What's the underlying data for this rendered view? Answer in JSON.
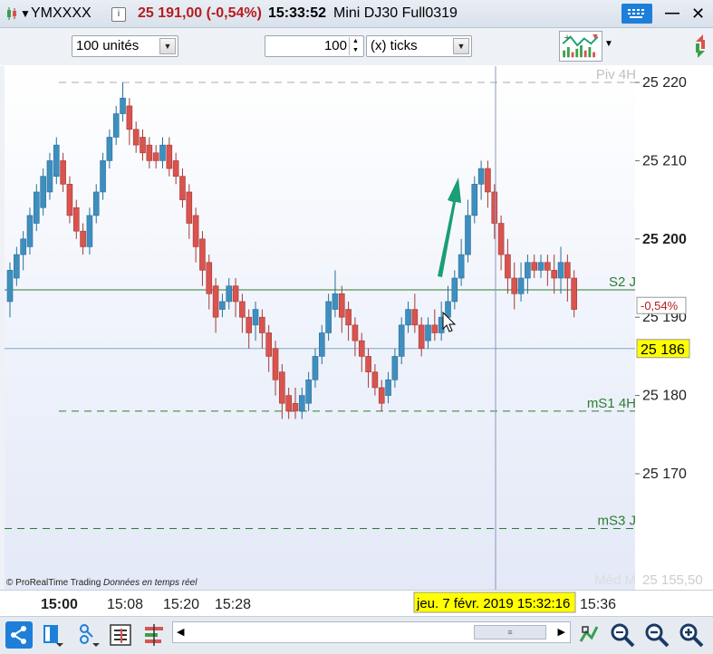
{
  "window": {
    "instrument": "YMXXXX",
    "price_change": "25 191,00 (-0,54%)",
    "time": "15:33:52",
    "name": "Mini DJ30 Full0319",
    "info_icon": "i",
    "minimize_label": "—",
    "close_label": "✕"
  },
  "toolbar": {
    "quantity": "100 unités",
    "tick_count": "100",
    "tick_unit": "(x) ticks"
  },
  "chart": {
    "copyright": "© ProRealTime Trading",
    "data_note": "Données en temps réel",
    "price_labels": [
      "25 220",
      "25 210",
      "25 200",
      "25 190",
      "25 180",
      "25 170"
    ],
    "current_price": "25 186",
    "change_pct": "-0,54%",
    "bottom_label": "25 155,50",
    "level_labels": {
      "piv": "Piv 4H",
      "s2": "S2 J",
      "ms1": "mS1 4H",
      "ms3": "mS3 J",
      "med": "Méd M"
    },
    "time_labels": [
      "15:00",
      "15:08",
      "15:20",
      "15:28",
      "15:36"
    ],
    "crosshair_label": "jeu. 7 févr. 2019 15:32:16"
  },
  "colors": {
    "up": "#3e8fbf",
    "down": "#d9534f",
    "arrow": "#1a9e75",
    "level_green": "#2e7d32",
    "price_red": "#b71c1c",
    "highlight": "#ffff00"
  },
  "chart_data": {
    "type": "candlestick",
    "y_range": [
      25152,
      25225
    ],
    "levels": {
      "Piv 4H": 25220,
      "S2 J": 25193.5,
      "mS1 4H": 25178,
      "mS3 J": 25163,
      "current": 25186
    },
    "candles": [
      [
        25192,
        25196,
        25190,
        25197
      ],
      [
        25195,
        25198,
        25194,
        25199
      ],
      [
        25198,
        25200,
        25196,
        25201
      ],
      [
        25199,
        25203,
        25198,
        25204
      ],
      [
        25202,
        25206,
        25201,
        25207
      ],
      [
        25204,
        25208,
        25203,
        25209
      ],
      [
        25206,
        25210,
        25205,
        25211
      ],
      [
        25208,
        25212,
        25207,
        25213
      ],
      [
        25210,
        25207,
        25206,
        25211
      ],
      [
        25207,
        25203,
        25202,
        25208
      ],
      [
        25204,
        25201,
        25200,
        25205
      ],
      [
        25201,
        25199,
        25198,
        25202
      ],
      [
        25199,
        25203,
        25198,
        25204
      ],
      [
        25203,
        25206,
        25202,
        25207
      ],
      [
        25206,
        25210,
        25205,
        25211
      ],
      [
        25210,
        25213,
        25209,
        25214
      ],
      [
        25213,
        25216,
        25212,
        25217
      ],
      [
        25216,
        25218,
        25215,
        25220
      ],
      [
        25217,
        25214,
        25212,
        25218
      ],
      [
        25214,
        25212,
        25211,
        25215
      ],
      [
        25213,
        25211,
        25210,
        25214
      ],
      [
        25212,
        25210,
        25209,
        25213
      ],
      [
        25211,
        25210,
        25209,
        25212
      ],
      [
        25210,
        25212,
        25209,
        25213
      ],
      [
        25212,
        25209,
        25208,
        25213
      ],
      [
        25210,
        25208,
        25207,
        25211
      ],
      [
        25208,
        25205,
        25204,
        25209
      ],
      [
        25206,
        25202,
        25200,
        25207
      ],
      [
        25203,
        25199,
        25197,
        25204
      ],
      [
        25200,
        25196,
        25194,
        25201
      ],
      [
        25197,
        25193,
        25191,
        25198
      ],
      [
        25194,
        25190,
        25188,
        25195
      ],
      [
        25191,
        25192,
        25190,
        25193
      ],
      [
        25192,
        25194,
        25191,
        25195
      ],
      [
        25194,
        25192,
        25190,
        25195
      ],
      [
        25192,
        25190,
        25188,
        25193
      ],
      [
        25190,
        25188,
        25186,
        25191
      ],
      [
        25189,
        25191,
        25187,
        25192
      ],
      [
        25190,
        25188,
        25186,
        25191
      ],
      [
        25188,
        25185,
        25183,
        25189
      ],
      [
        25186,
        25182,
        25180,
        25187
      ],
      [
        25183,
        25179,
        25177,
        25184
      ],
      [
        25180,
        25178,
        25177,
        25181
      ],
      [
        25179,
        25178,
        25177,
        25181
      ],
      [
        25178,
        25180,
        25177,
        25181
      ],
      [
        25179,
        25182,
        25178,
        25183
      ],
      [
        25182,
        25185,
        25181,
        25186
      ],
      [
        25185,
        25188,
        25184,
        25189
      ],
      [
        25188,
        25192,
        25187,
        25193
      ],
      [
        25191,
        25193,
        25190,
        25196
      ],
      [
        25193,
        25190,
        25188,
        25194
      ],
      [
        25191,
        25189,
        25187,
        25192
      ],
      [
        25189,
        25187,
        25185,
        25190
      ],
      [
        25187,
        25185,
        25183,
        25188
      ],
      [
        25185,
        25183,
        25181,
        25186
      ],
      [
        25183,
        25181,
        25180,
        25184
      ],
      [
        25181,
        25179,
        25178,
        25182
      ],
      [
        25180,
        25182,
        25179,
        25183
      ],
      [
        25182,
        25185,
        25181,
        25186
      ],
      [
        25185,
        25189,
        25184,
        25190
      ],
      [
        25189,
        25191,
        25188,
        25192
      ],
      [
        25191,
        25189,
        25188,
        25193
      ],
      [
        25189,
        25186,
        25185,
        25190
      ],
      [
        25187,
        25189,
        25186,
        25190
      ],
      [
        25189,
        25188,
        25187,
        25191
      ],
      [
        25188,
        25190,
        25187,
        25192
      ],
      [
        25190,
        25192,
        25189,
        25194
      ],
      [
        25192,
        25195,
        25191,
        25196
      ],
      [
        25195,
        25198,
        25194,
        25200
      ],
      [
        25198,
        25203,
        25197,
        25205
      ],
      [
        25203,
        25207,
        25202,
        25208
      ],
      [
        25207,
        25209,
        25205,
        25210
      ],
      [
        25209,
        25206,
        25204,
        25210
      ],
      [
        25206,
        25202,
        25200,
        25207
      ],
      [
        25202,
        25198,
        25196,
        25203
      ],
      [
        25198,
        25195,
        25193,
        25200
      ],
      [
        25195,
        25193,
        25191,
        25197
      ],
      [
        25193,
        25195,
        25192,
        25197
      ],
      [
        25195,
        25197,
        25193,
        25198
      ],
      [
        25197,
        25196,
        25195,
        25198
      ],
      [
        25196,
        25197,
        25195,
        25198
      ],
      [
        25197,
        25196,
        25194,
        25198
      ],
      [
        25196,
        25195,
        25193,
        25198
      ],
      [
        25195,
        25197,
        25193,
        25199
      ],
      [
        25197,
        25195,
        25192,
        25198
      ],
      [
        25195,
        25191,
        25190,
        25196
      ]
    ]
  }
}
